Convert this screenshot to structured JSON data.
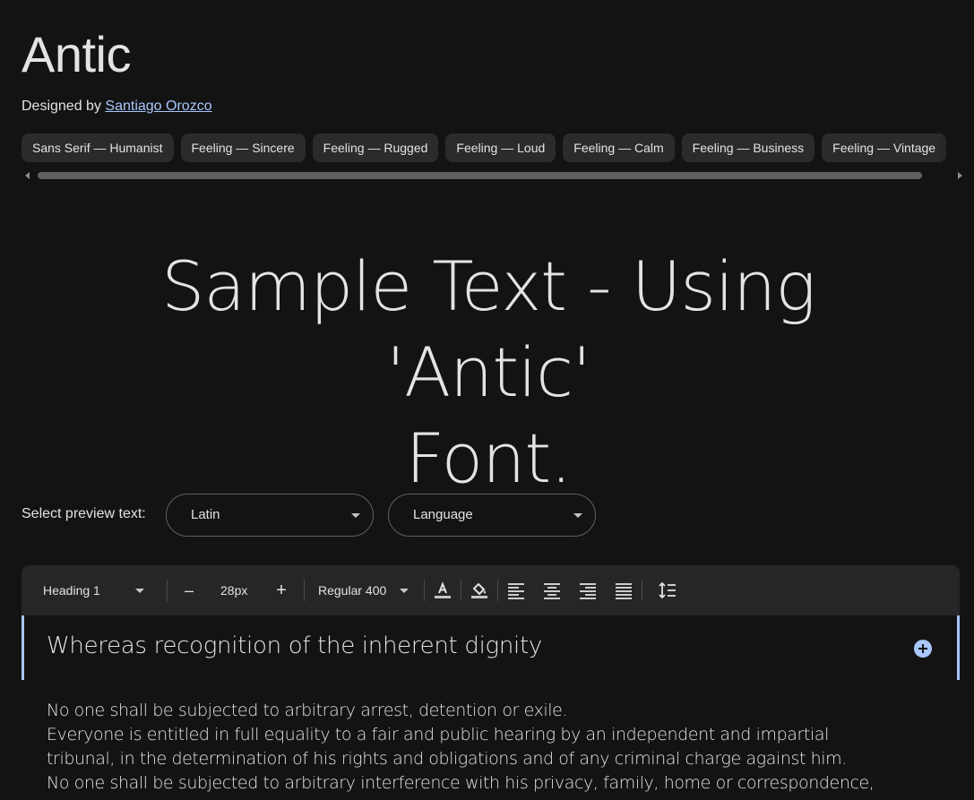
{
  "font": {
    "name": "Antic",
    "designed_by_label": "Designed by",
    "designer": "Santiago Orozco"
  },
  "tags": [
    "Sans Serif — Humanist",
    "Feeling — Sincere",
    "Feeling — Rugged",
    "Feeling — Loud",
    "Feeling — Calm",
    "Feeling — Business",
    "Feeling — Vintage"
  ],
  "sample": {
    "line1": "Sample Text - Using 'Antic'",
    "line2": "Font."
  },
  "preview": {
    "label": "Select preview text:",
    "script_value": "Latin",
    "language_value": "Language"
  },
  "toolbar": {
    "style": "Heading 1",
    "decrease": "–",
    "size": "28px",
    "increase": "+",
    "weight": "Regular 400"
  },
  "editor": {
    "heading": "Whereas recognition of the inherent dignity",
    "paragraph_lines": [
      "No one shall be subjected to arbitrary arrest, detention or exile.",
      "Everyone is entitled in full equality to a fair and public hearing by an independent and impartial",
      "tribunal, in the determination of his rights and obligations and of any criminal charge against him.",
      "No one shall be subjected to arbitrary interference with his privacy, family, home or correspondence,"
    ]
  },
  "colors": {
    "background": "#131314",
    "link": "#a8c7fa",
    "chip": "#2b2b2d",
    "toolbar": "#262628",
    "accent": "#a8c7fa"
  }
}
